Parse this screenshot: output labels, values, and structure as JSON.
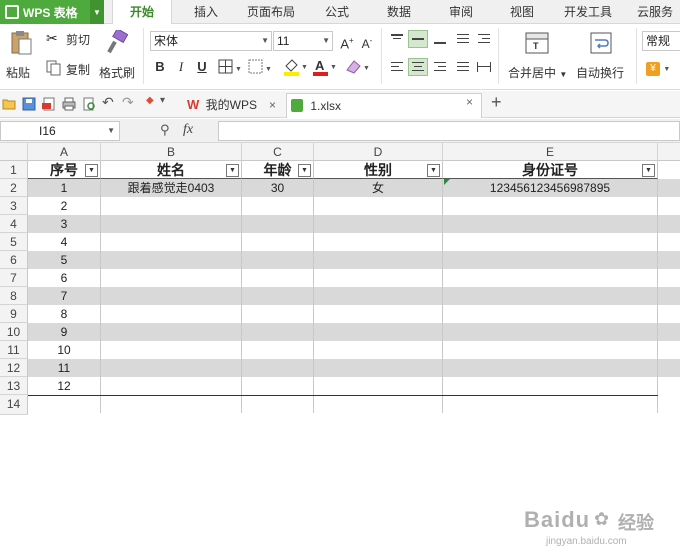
{
  "app": {
    "name": "WPS 表格"
  },
  "menu": {
    "tabs": [
      "开始",
      "插入",
      "页面布局",
      "公式",
      "数据",
      "审阅",
      "视图",
      "开发工具",
      "云服务"
    ],
    "active": "开始"
  },
  "ribbon": {
    "paste": "粘贴",
    "cut": "剪切",
    "copy": "复制",
    "format_painter": "格式刷",
    "font_name": "宋体",
    "font_size": "11",
    "merge_center": "合并居中",
    "wrap_text": "自动换行",
    "number_format": "常规",
    "bold": "B",
    "italic": "I",
    "underline": "U"
  },
  "doc_tabs": [
    {
      "label": "我的WPS",
      "close": "×"
    },
    {
      "label": "1.xlsx",
      "close": "×"
    }
  ],
  "new_tab": "+",
  "formula_bar": {
    "cell_ref": "I16",
    "fx": "fx",
    "content": ""
  },
  "columns": [
    "A",
    "B",
    "C",
    "D",
    "E"
  ],
  "rows": [
    "1",
    "2",
    "3",
    "4",
    "5",
    "6",
    "7",
    "8",
    "9",
    "10",
    "11",
    "12",
    "13",
    "14"
  ],
  "table": {
    "headers": [
      "序号",
      "姓名",
      "年龄",
      "性别",
      "身份证号"
    ],
    "data": [
      [
        "1",
        "跟着感觉走0403",
        "30",
        "女",
        "123456123456987895"
      ],
      [
        "2",
        "",
        "",
        "",
        ""
      ],
      [
        "3",
        "",
        "",
        "",
        ""
      ],
      [
        "4",
        "",
        "",
        "",
        ""
      ],
      [
        "5",
        "",
        "",
        "",
        ""
      ],
      [
        "6",
        "",
        "",
        "",
        ""
      ],
      [
        "7",
        "",
        "",
        "",
        ""
      ],
      [
        "8",
        "",
        "",
        "",
        ""
      ],
      [
        "9",
        "",
        "",
        "",
        ""
      ],
      [
        "10",
        "",
        "",
        "",
        ""
      ],
      [
        "11",
        "",
        "",
        "",
        ""
      ],
      [
        "12",
        "",
        "",
        "",
        ""
      ]
    ]
  },
  "watermark": {
    "brand": "Baidu",
    "suffix": "经验",
    "url": "jingyan.baidu.com"
  },
  "colors": {
    "accent": "#4eaa3c",
    "stripe": "#d9d9d9"
  }
}
